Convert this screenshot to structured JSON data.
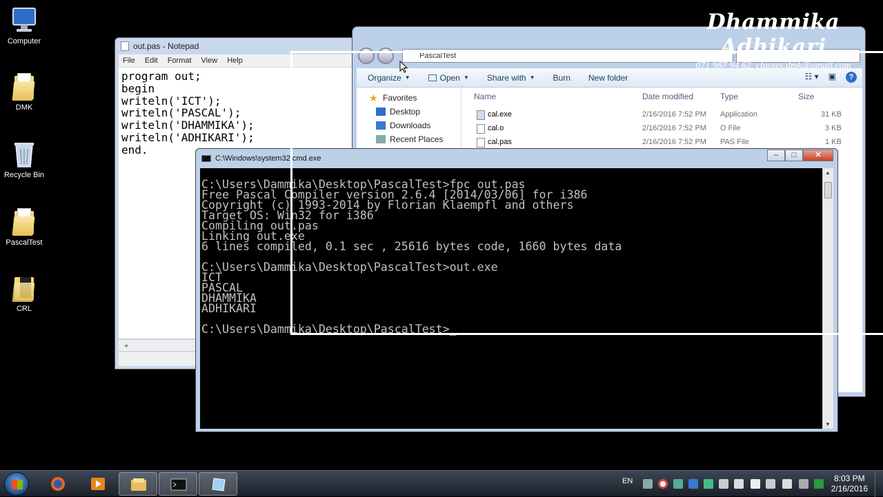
{
  "desktop_icons": [
    {
      "label": "Computer",
      "icon": "computer-icon"
    },
    {
      "label": "DMK",
      "icon": "folder-icon"
    },
    {
      "label": "Recycle Bin",
      "icon": "recycle-bin-icon"
    },
    {
      "label": "PascalTest",
      "icon": "folder-icon"
    },
    {
      "label": "CRL",
      "icon": "folder-icon"
    }
  ],
  "watermark": {
    "name": "Dhammika Adhikari",
    "contact": "071 987 94 62, classes.dmk@gmail.com"
  },
  "notepad": {
    "title": "out.pas - Notepad",
    "menu": [
      "File",
      "Edit",
      "Format",
      "View",
      "Help"
    ],
    "content": "program out;\nbegin\nwriteln('ICT');\nwriteln('PASCAL');\nwriteln('DHAMMIKA');\nwriteln('ADHIKARI');\nend."
  },
  "explorer": {
    "address": "PascalTest",
    "toolbar": [
      "Organize",
      "Open",
      "Share with",
      "Burn",
      "New folder"
    ],
    "nav": [
      "Favorites",
      "Desktop",
      "Downloads",
      "Recent Places"
    ],
    "columns": [
      "Name",
      "Date modified",
      "Type",
      "Size"
    ],
    "files": [
      {
        "name": "cal.exe",
        "date": "2/16/2016 7:52 PM",
        "type": "Application",
        "size": "31 KB"
      },
      {
        "name": "cal.o",
        "date": "2/16/2016 7:52 PM",
        "type": "O File",
        "size": "3 KB"
      },
      {
        "name": "cal.pas",
        "date": "2/16/2016 7:52 PM",
        "type": "PAS File",
        "size": "1 KB"
      }
    ]
  },
  "cmd": {
    "title": "C:\\Windows\\system32\\cmd.exe",
    "controls": [
      "–",
      "□",
      "✕"
    ],
    "output": "C:\\Users\\Dammika\\Desktop\\PascalTest>fpc out.pas\nFree Pascal Compiler version 2.6.4 [2014/03/06] for i386\nCopyright (c) 1993-2014 by Florian Klaempfl and others\nTarget OS: Win32 for i386\nCompiling out.pas\nLinking out.exe\n6 lines compiled, 0.1 sec , 25616 bytes code, 1660 bytes data\n\nC:\\Users\\Dammika\\Desktop\\PascalTest>out.exe\nICT\nPASCAL\nDHAMMIKA\nADHIKARI\n\nC:\\Users\\Dammika\\Desktop\\PascalTest>_"
  },
  "taskbar": {
    "language": "EN",
    "time": "8:03 PM",
    "date": "2/16/2016",
    "apps": [
      "firefox-icon",
      "media-player-icon",
      "explorer-icon",
      "cmd-icon",
      "notepad-icon"
    ]
  }
}
